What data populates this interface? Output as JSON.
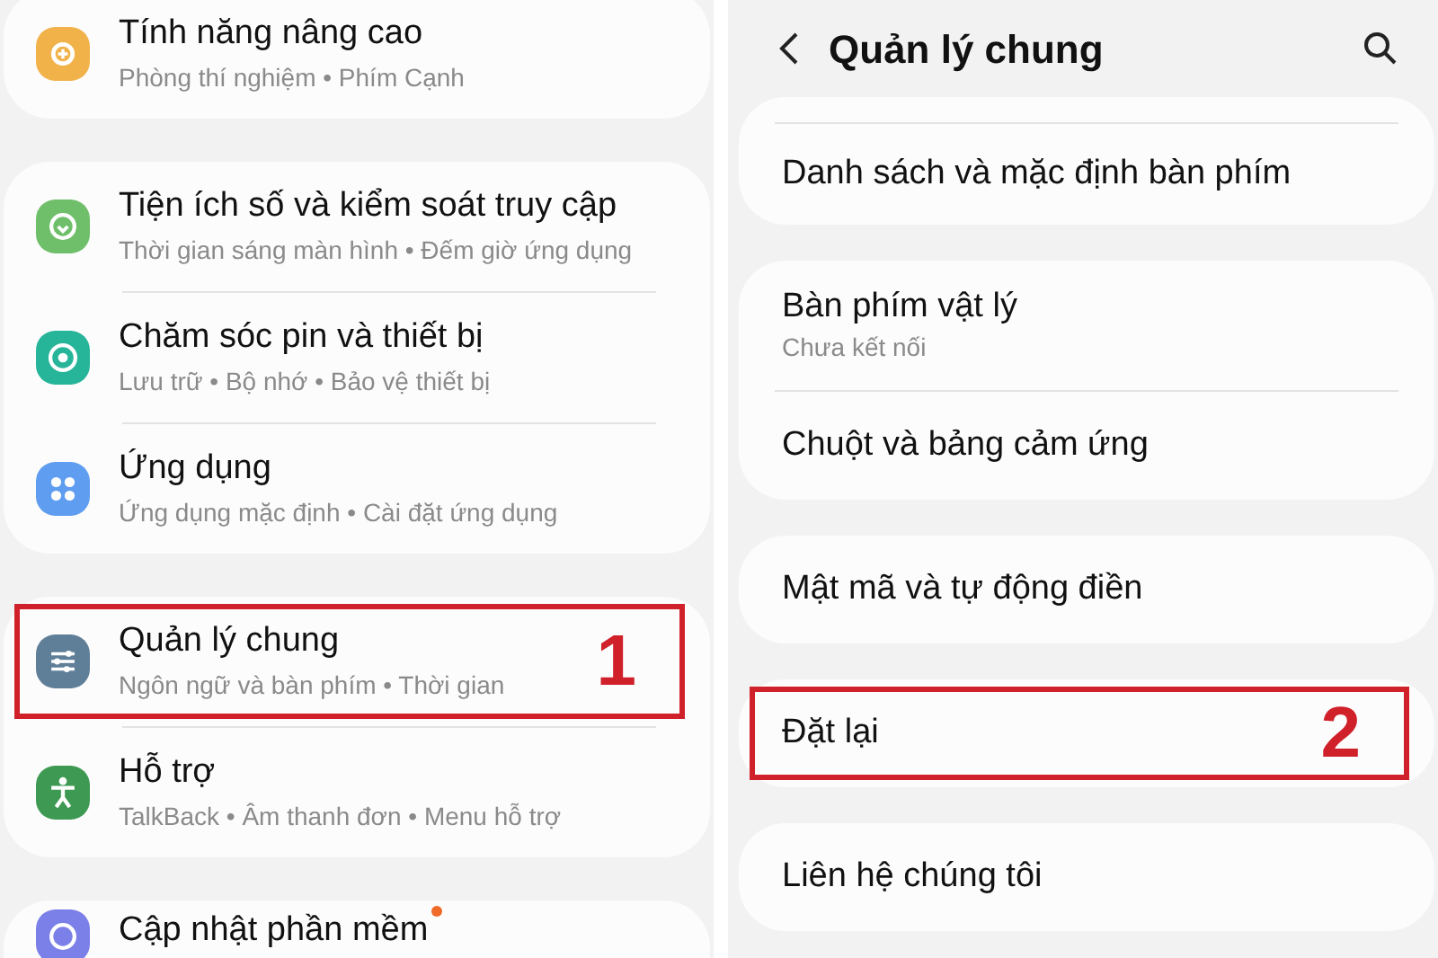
{
  "left_screen": {
    "groups": [
      {
        "items": [
          {
            "title": "Tính năng nâng cao",
            "subtitle": "Phòng thí nghiệm • Phím Cạnh",
            "color": "#f2b24a"
          }
        ]
      },
      {
        "items": [
          {
            "title": "Tiện ích số và kiểm soát truy cập",
            "subtitle": "Thời gian sáng màn hình • Đếm giờ ứng dụng",
            "color": "#6fbf6a"
          },
          {
            "title": "Chăm sóc pin và thiết bị",
            "subtitle": "Lưu trữ • Bộ nhớ • Bảo vệ thiết bị",
            "color": "#27b59a"
          },
          {
            "title": "Ứng dụng",
            "subtitle": "Ứng dụng mặc định • Cài đặt ứng dụng",
            "color": "#5e9df0"
          }
        ]
      },
      {
        "items": [
          {
            "title": "Quản lý chung",
            "subtitle": "Ngôn ngữ và bàn phím • Thời gian",
            "color": "#5f7f99",
            "step": "1"
          },
          {
            "title": "Hỗ trợ",
            "subtitle": "TalkBack • Âm thanh đơn • Menu hỗ trợ",
            "color": "#3e9a52"
          }
        ]
      },
      {
        "items": [
          {
            "title": "Cập nhật phần mềm",
            "color": "#7b7fe8",
            "new_badge": true
          }
        ]
      }
    ]
  },
  "right_screen": {
    "title": "Quản lý chung",
    "groups": [
      {
        "items": [
          {
            "title": "Danh sách và mặc định bàn phím"
          }
        ]
      },
      {
        "items": [
          {
            "title": "Bàn phím vật lý",
            "subtitle": "Chưa kết nối"
          },
          {
            "title": "Chuột và bảng cảm ứng"
          }
        ]
      },
      {
        "items": [
          {
            "title": "Mật mã và tự động điền"
          }
        ]
      },
      {
        "items": [
          {
            "title": "Đặt lại",
            "step": "2"
          }
        ]
      },
      {
        "items": [
          {
            "title": "Liên hệ chúng tôi"
          }
        ]
      }
    ]
  }
}
